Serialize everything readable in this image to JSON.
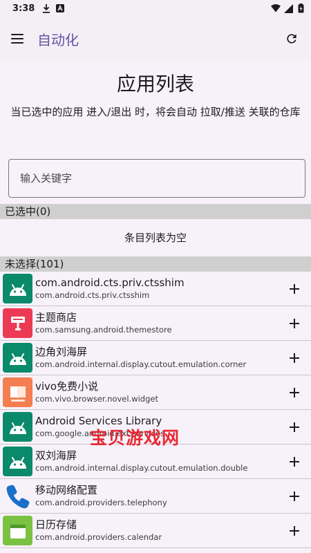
{
  "status_bar": {
    "time": "3:38"
  },
  "app_bar": {
    "title": "自动化"
  },
  "page": {
    "title": "应用列表",
    "description": "当已选中的应用 进入/退出 时，将会自动 拉取/推送 关联的仓库"
  },
  "search": {
    "placeholder": "输入关键字"
  },
  "selected_section": {
    "header": "已选中(0)",
    "empty_text": "条目列表为空"
  },
  "unselected_section": {
    "header": "未选择(101)"
  },
  "apps": [
    {
      "name": "com.android.cts.priv.ctsshim",
      "package": "com.android.cts.priv.ctsshim",
      "icon": "android-icon"
    },
    {
      "name": "主题商店",
      "package": "com.samsung.android.themestore",
      "icon": "theme-store-icon"
    },
    {
      "name": "边角刘海屏",
      "package": "com.android.internal.display.cutout.emulation.corner",
      "icon": "android-icon"
    },
    {
      "name": "vivo免费小说",
      "package": "com.vivo.browser.novel.widget",
      "icon": "novel-icon"
    },
    {
      "name": "Android Services Library",
      "package": "com.google.android.ext.services",
      "icon": "android-icon"
    },
    {
      "name": "双刘海屏",
      "package": "com.android.internal.display.cutout.emulation.double",
      "icon": "android-icon"
    },
    {
      "name": "移动网络配置",
      "package": "com.android.providers.telephony",
      "icon": "phone-icon"
    },
    {
      "name": "日历存储",
      "package": "com.android.providers.calendar",
      "icon": "calendar-icon"
    }
  ],
  "watermark": {
    "text": "宝贝游戏网"
  },
  "colors": {
    "accent": "#6750a4",
    "android_green": "#0a8a6b",
    "section_gray": "#cfcfcf"
  }
}
